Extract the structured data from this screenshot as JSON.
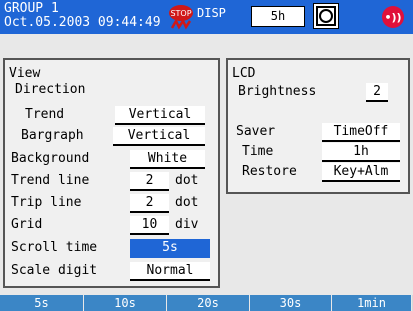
{
  "header": {
    "group": "GROUP 1",
    "datetime": "Oct.05.2003 09:44:49",
    "disp_label": "DISP",
    "interval": "5h"
  },
  "view": {
    "title": "View",
    "direction_label": "Direction",
    "trend_label": "Trend",
    "trend_value": "Vertical",
    "bargraph_label": "Bargraph",
    "bargraph_value": "Vertical",
    "background_label": "Background",
    "background_value": "White",
    "trend_line_label": "Trend line",
    "trend_line_value": "2",
    "trend_line_unit": "dot",
    "trip_line_label": "Trip line",
    "trip_line_value": "2",
    "trip_line_unit": "dot",
    "grid_label": "Grid",
    "grid_value": "10",
    "grid_unit": "div",
    "scroll_time_label": "Scroll time",
    "scroll_time_value": "5s",
    "scale_digit_label": "Scale digit",
    "scale_digit_value": "Normal"
  },
  "lcd": {
    "title": "LCD",
    "brightness_label": "Brightness",
    "brightness_value": "2",
    "saver_label": "Saver",
    "saver_value": "TimeOff",
    "time_label": "Time",
    "time_value": "1h",
    "restore_label": "Restore",
    "restore_value": "Key+Alm"
  },
  "softkeys": [
    "5s",
    "10s",
    "20s",
    "30s",
    "1min"
  ],
  "colors": {
    "accent": "#1f66d6",
    "softkey": "#3b86c6",
    "alarm": "#e0103a"
  }
}
